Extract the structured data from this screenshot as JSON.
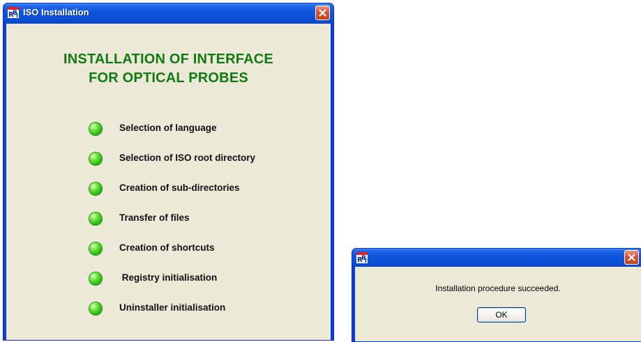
{
  "colors": {
    "titlebar_blue": "#0a4fd6",
    "client_beige": "#ece9d8",
    "heading_green": "#127a12",
    "led_green": "#2fbd14",
    "close_red": "#d8573a"
  },
  "main_window": {
    "title": "ISO Installation",
    "icon": "rbi-app-icon",
    "heading_line1": "INSTALLATION OF INTERFACE",
    "heading_line2": "FOR OPTICAL PROBES",
    "steps": [
      {
        "label": "Selection of language",
        "status": "completed"
      },
      {
        "label": "Selection of ISO root directory",
        "status": "completed"
      },
      {
        "label": "Creation of sub-directories",
        "status": "completed"
      },
      {
        "label": "Transfer of files",
        "status": "completed"
      },
      {
        "label": "Creation of shortcuts",
        "status": "completed"
      },
      {
        "label": " Registry initialisation",
        "status": "completed"
      },
      {
        "label": "Uninstaller initialisation",
        "status": "completed"
      }
    ]
  },
  "message_box": {
    "title": "",
    "icon": "rbi-app-icon",
    "message": "Installation procedure succeeded.",
    "ok_label": "OK"
  }
}
